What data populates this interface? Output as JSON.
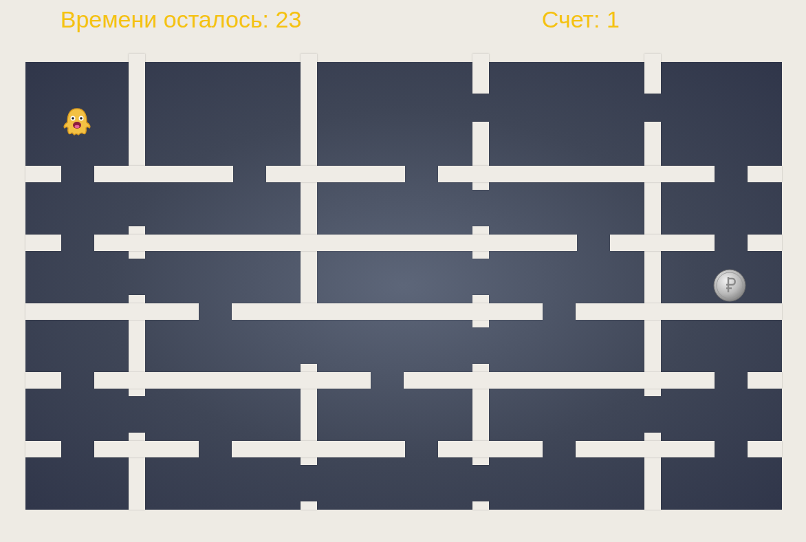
{
  "hud": {
    "timer": "Времени осталось: 23",
    "score": "Счет: 1"
  }
}
